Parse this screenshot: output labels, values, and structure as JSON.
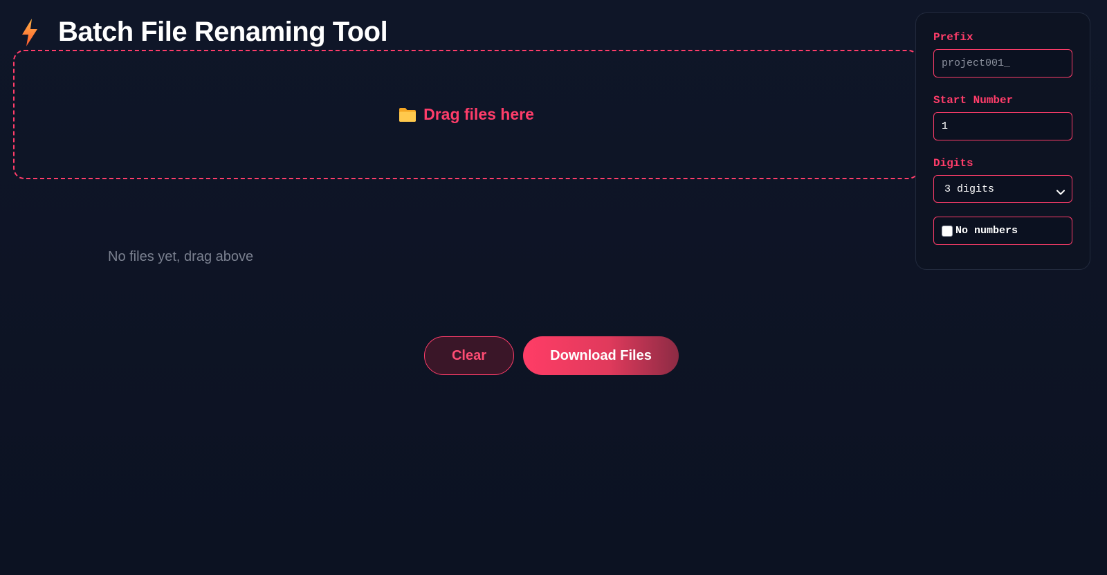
{
  "header": {
    "title": "Batch File Renaming Tool",
    "icon": "lightning-bolt-icon"
  },
  "dropzone": {
    "icon": "folder-icon",
    "text": "Drag files here"
  },
  "file_list": {
    "empty_text": "No files yet, drag above"
  },
  "actions": {
    "clear_label": "Clear",
    "download_label": "Download Files"
  },
  "settings": {
    "prefix_label": "Prefix",
    "prefix_placeholder": "project001_",
    "prefix_value": "",
    "start_number_label": "Start Number",
    "start_number_value": "1",
    "digits_label": "Digits",
    "digits_selected": "3 digits",
    "no_numbers_label": "No numbers",
    "no_numbers_checked": false
  },
  "colors": {
    "accent": "#ff3d6a",
    "background": "#0e1425",
    "bolt": "#ff8a3d",
    "folder": "#ffc94d"
  }
}
